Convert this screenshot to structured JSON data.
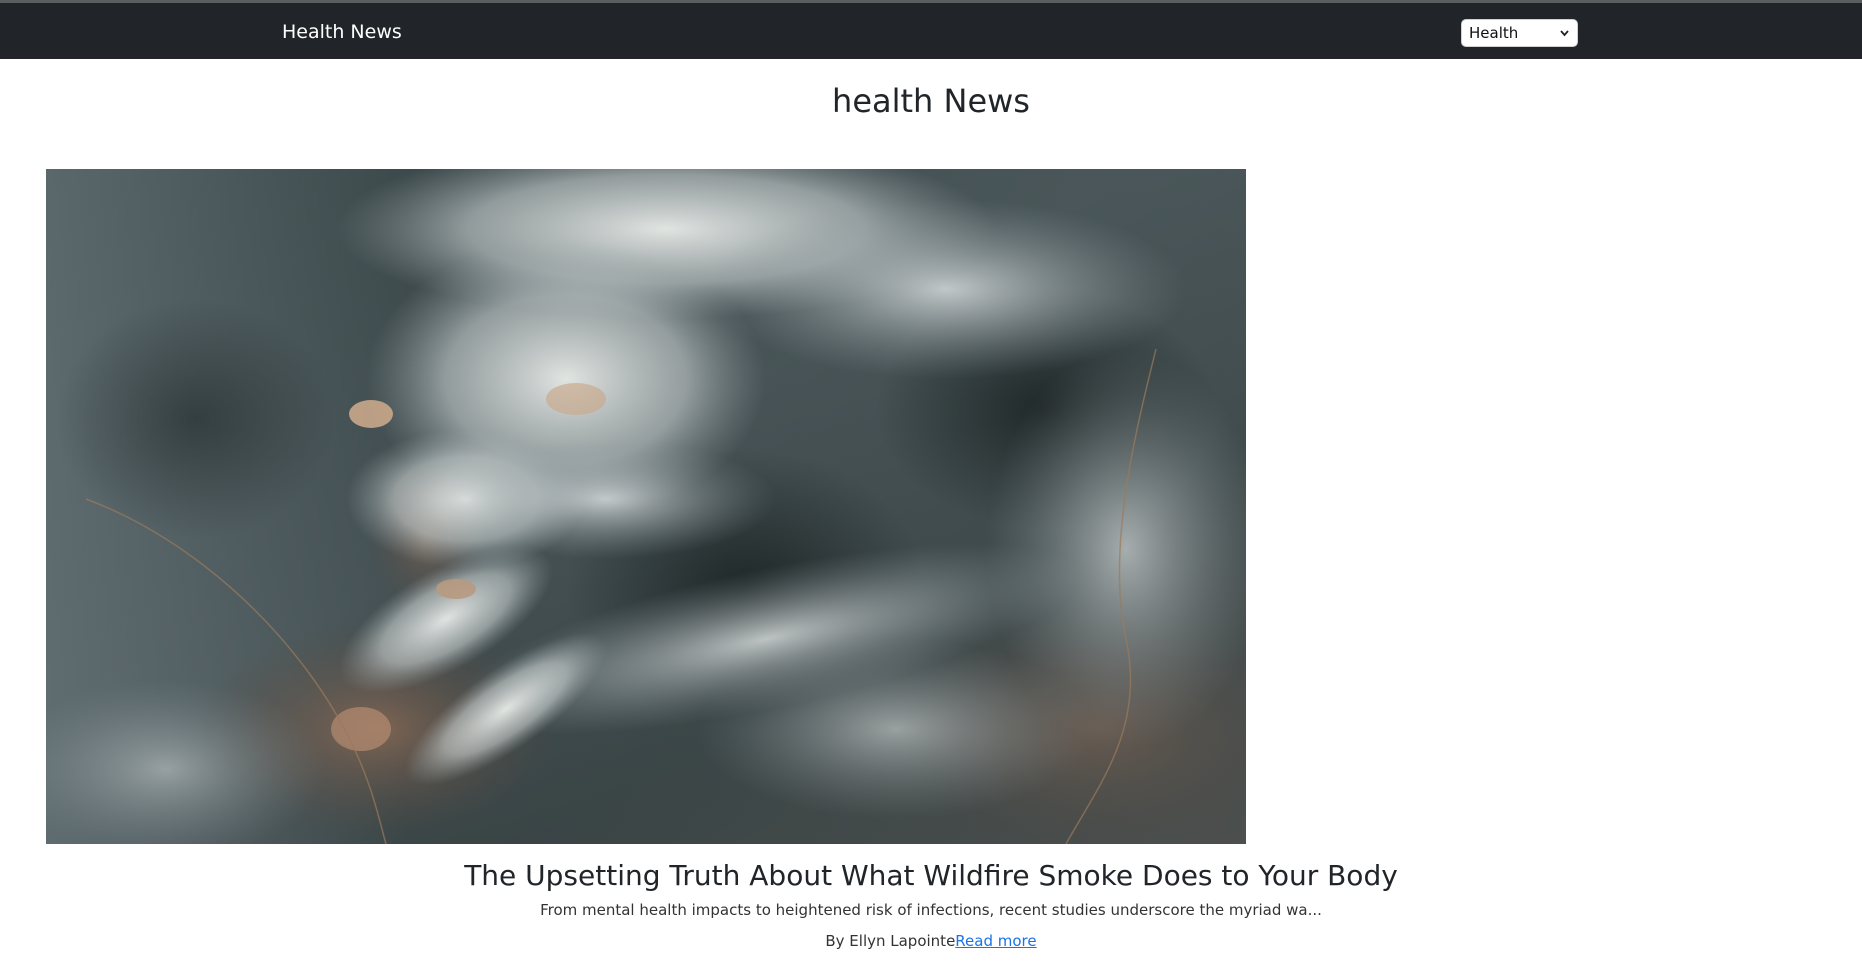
{
  "navbar": {
    "brand": "Health News",
    "category_select": {
      "selected": "Health",
      "icon": "chevron-down-icon"
    }
  },
  "page": {
    "title": "health News"
  },
  "article": {
    "image_description_icon": "article-image",
    "title": "The Upsetting Truth About What Wildfire Smoke Does to Your Body",
    "summary": "From mental health impacts to heightened risk of infections, recent studies underscore the myriad wa...",
    "byline": "By Ellyn Lapointe",
    "read_more": "Read more"
  },
  "colors": {
    "navbar_bg": "#212529",
    "link": "#1a73e8",
    "text": "#212529"
  }
}
